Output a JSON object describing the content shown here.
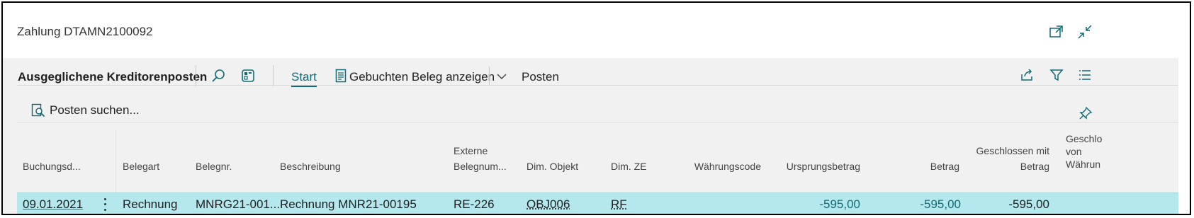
{
  "window": {
    "title": "Zahlung DTAMN2100092"
  },
  "actionbar": {
    "page_title": "Ausgeglichene Kreditorenposten",
    "start": "Start",
    "show_posted": "Gebuchten Beleg anzeigen",
    "posten": "Posten"
  },
  "subbar": {
    "find_entries": "Posten suchen..."
  },
  "table": {
    "headers": {
      "buchungsdatum": "Buchungsd...",
      "belegart": "Belegart",
      "belegnr": "Belegnr.",
      "beschreibung": "Beschreibung",
      "externe_line1": "Externe",
      "externe_line2": "Belegnum...",
      "dim_objekt": "Dim. Objekt",
      "dim_ze": "Dim. ZE",
      "waehrungscode": "Währungscode",
      "ursprungsbetrag": "Ursprungsbetrag",
      "betrag": "Betrag",
      "geschlossen_line1": "Geschlossen mit",
      "geschlossen_line2": "Betrag",
      "geschl_w_line1": "Geschlo",
      "geschl_w_line2": "von",
      "geschl_w_line3": "Währun"
    },
    "rows": [
      {
        "buchungsdatum": "09.01.2021",
        "belegart": "Rechnung",
        "belegnr": "MNRG21-001...",
        "beschreibung": "Rechnung MNR21-00195",
        "externe": "RE-226",
        "dim_objekt": "OBJ006",
        "dim_ze": "RF",
        "waehrungscode": "",
        "ursprungsbetrag": "-595,00",
        "betrag": "-595,00",
        "geschlossen": "-595,00"
      }
    ]
  },
  "colors": {
    "accent": "#0f6b73",
    "selected_row": "#b4e8ec",
    "band": "#f1f1f1"
  }
}
